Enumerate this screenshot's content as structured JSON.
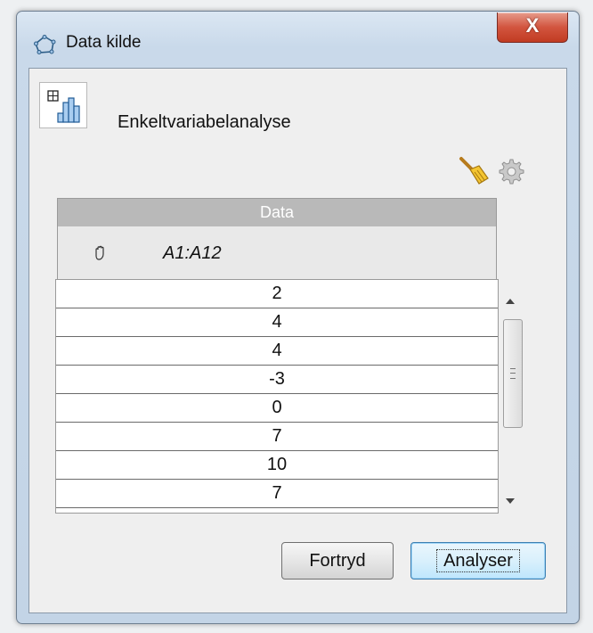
{
  "window": {
    "title": "Data kilde",
    "close_label": "X"
  },
  "tool": {
    "label": "Enkeltvariabelanalyse",
    "icon": "one-variable-analysis-icon"
  },
  "toolbar_icons": [
    "broom-icon",
    "gear-icon"
  ],
  "table": {
    "column_header": "Data",
    "source_range": "A1:A12",
    "rows": [
      "2",
      "4",
      "4",
      "-3",
      "0",
      "7",
      "10",
      "7"
    ]
  },
  "buttons": {
    "cancel_label": "Fortryd",
    "ok_label": "Analyser"
  }
}
